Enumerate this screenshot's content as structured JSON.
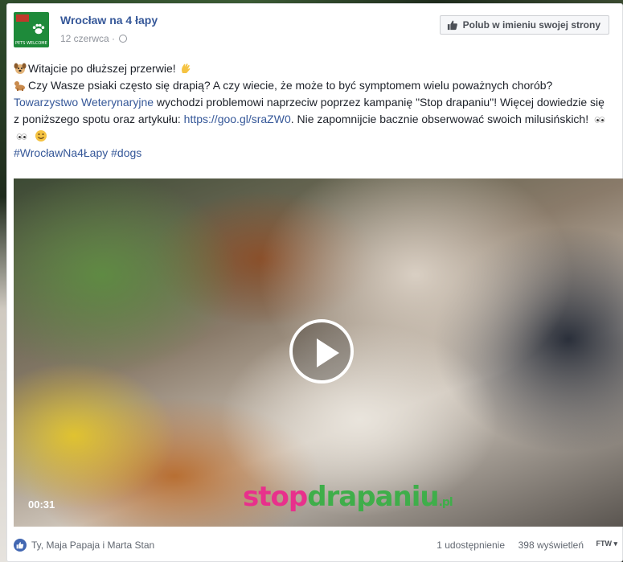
{
  "post": {
    "page_name": "Wrocław na 4 łapy",
    "date": "12 czerwca",
    "separator": "·",
    "like_page_label": "Polub w imieniu swojej strony",
    "avatar_text": "PETS WELCOME",
    "lines": {
      "greeting": "Witajcie po dłuższej przerwie!",
      "p2_before": "Czy Wasze psiaki często się drapią? A czy wiecie, że może to być symptomem wielu poważnych chorób?",
      "p2_link": "Towarzystwo Weterynaryjne",
      "p2_middle": "wychodzi problemowi naprzeciw poprzez kampanię \"Stop drapaniu\"! Więcej dowiedzie się z poniższego spotu oraz artykułu:",
      "p2_url": "https://goo.gl/sraZW0",
      "p2_after": ". Nie zapomnijcie bacznie obserwować swoich milusińskich!",
      "hashtags": "#WrocławNa4Łapy #dogs"
    }
  },
  "video": {
    "duration": "00:31",
    "watermark_a": "stop",
    "watermark_b": "drapaniu",
    "watermark_c": ".pl"
  },
  "footer": {
    "reactors": "Ty, Maja Papaja i Marta Stan",
    "shares": "1 udostępnienie",
    "views": "398 wyświetleń",
    "lang": "FTW ▾"
  },
  "colors": {
    "link": "#365899",
    "like_blue": "#4267b2",
    "brand_green": "#1e8a3a"
  },
  "icons": [
    "globe-icon",
    "thumbs-up-icon",
    "dog-emoji-icon",
    "wave-emoji-icon",
    "eyes-emoji-icon",
    "smile-emoji-icon",
    "play-icon"
  ]
}
